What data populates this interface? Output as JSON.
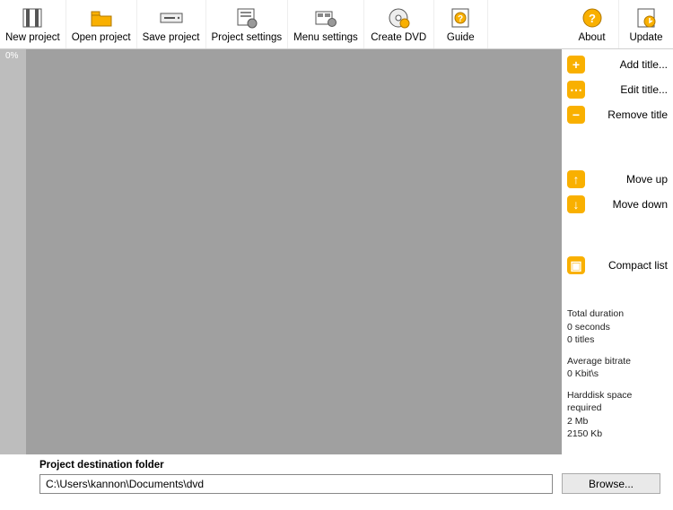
{
  "toolbar": {
    "new_project": "New project",
    "open_project": "Open project",
    "save_project": "Save project",
    "project_settings": "Project settings",
    "menu_settings": "Menu settings",
    "create_dvd": "Create DVD",
    "guide": "Guide",
    "about": "About",
    "update": "Update"
  },
  "progress": {
    "label": "0%"
  },
  "side": {
    "add_title": "Add title...",
    "edit_title": "Edit title...",
    "remove_title": "Remove title",
    "move_up": "Move up",
    "move_down": "Move down",
    "compact_list": "Compact list"
  },
  "stats": {
    "duration_label": "Total duration",
    "duration_value": "0 seconds",
    "titles_value": "0 titles",
    "bitrate_label": "Average bitrate",
    "bitrate_value": "0 Kbit\\s",
    "space_label": "Harddisk space required",
    "space_value1": "2 Mb",
    "space_value2": "2150 Kb"
  },
  "dest": {
    "label": "Project destination folder",
    "path": "C:\\Users\\kannon\\Documents\\dvd",
    "browse": "Browse..."
  }
}
